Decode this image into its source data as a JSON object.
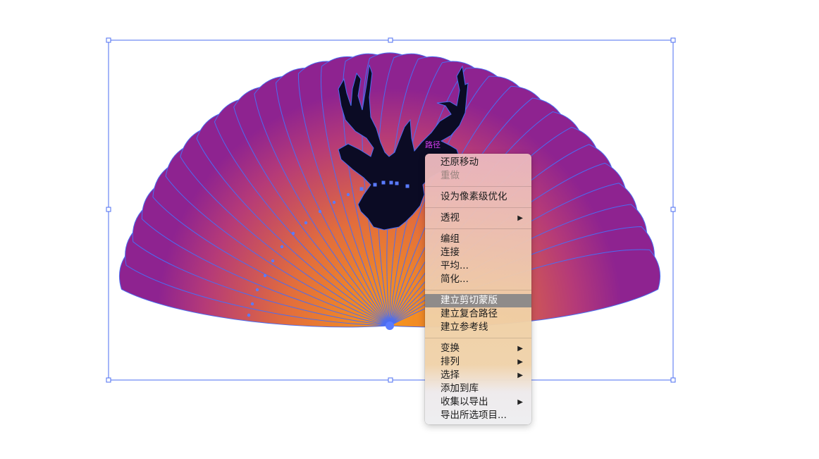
{
  "canvas": {
    "path_label": "路径",
    "colors": {
      "gradient_orange": "#f08c20",
      "gradient_purple": "#8e2390",
      "stroke_blue": "#4b6df2",
      "silhouette": "#0b0b24"
    }
  },
  "context_menu": {
    "groups": [
      [
        {
          "label": "还原移动",
          "disabled": false,
          "submenu": false
        },
        {
          "label": "重做",
          "disabled": true,
          "submenu": false
        }
      ],
      [
        {
          "label": "设为像素级优化",
          "disabled": false,
          "submenu": false
        }
      ],
      [
        {
          "label": "透视",
          "disabled": false,
          "submenu": true
        }
      ],
      [
        {
          "label": "编组",
          "disabled": false,
          "submenu": false
        },
        {
          "label": "连接",
          "disabled": false,
          "submenu": false
        },
        {
          "label": "平均...",
          "disabled": false,
          "submenu": false
        },
        {
          "label": "简化...",
          "disabled": false,
          "submenu": false
        }
      ],
      [
        {
          "label": "建立剪切蒙版",
          "disabled": false,
          "submenu": false,
          "highlighted": true
        },
        {
          "label": "建立复合路径",
          "disabled": false,
          "submenu": false
        },
        {
          "label": "建立参考线",
          "disabled": false,
          "submenu": false
        }
      ],
      [
        {
          "label": "变换",
          "disabled": false,
          "submenu": true
        },
        {
          "label": "排列",
          "disabled": false,
          "submenu": true
        },
        {
          "label": "选择",
          "disabled": false,
          "submenu": true
        },
        {
          "label": "添加到库",
          "disabled": false,
          "submenu": false
        },
        {
          "label": "收集以导出",
          "disabled": false,
          "submenu": true
        },
        {
          "label": "导出所选项目...",
          "disabled": false,
          "submenu": false
        }
      ]
    ]
  }
}
